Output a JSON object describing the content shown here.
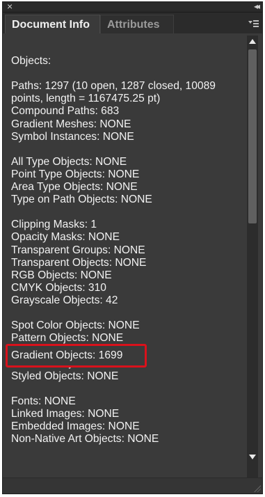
{
  "window": {
    "close_glyph": "×",
    "collapse_glyph": "◂◂"
  },
  "tabs": [
    {
      "label": "Document Info",
      "active": true
    },
    {
      "label": "Attributes",
      "active": false
    }
  ],
  "info_lines": [
    "Objects:",
    "",
    "Paths: 1297 (10 open, 1287 closed, 10089",
    "points, length = 1167475.25 pt)",
    "Compound Paths: 683",
    "Gradient Meshes: NONE",
    "Symbol Instances: NONE",
    "",
    "All Type Objects: NONE",
    "Point Type Objects: NONE",
    "Area Type Objects: NONE",
    "Type on Path Objects: NONE",
    "",
    "Clipping Masks: 1",
    "Opacity Masks: NONE",
    "Transparent Groups: NONE",
    "Transparent Objects: NONE",
    "RGB Objects: NONE",
    "CMYK Objects: 310",
    "Grayscale Objects: 42",
    "",
    "Spot Color Objects: NONE",
    "Pattern Objects: NONE",
    "Gradient Objects: 1699",
    "Brushed Objects: NONE",
    "Styled Objects: NONE",
    "",
    "Fonts: NONE",
    "Linked Images: NONE",
    "Embedded Images: NONE",
    "Non-Native Art Objects: NONE"
  ],
  "highlighted": "Gradient Objects: 1699",
  "colors": {
    "panel_bg": "#3a3a3a",
    "text": "#f2f2f2",
    "highlight_border": "#d9111b"
  }
}
